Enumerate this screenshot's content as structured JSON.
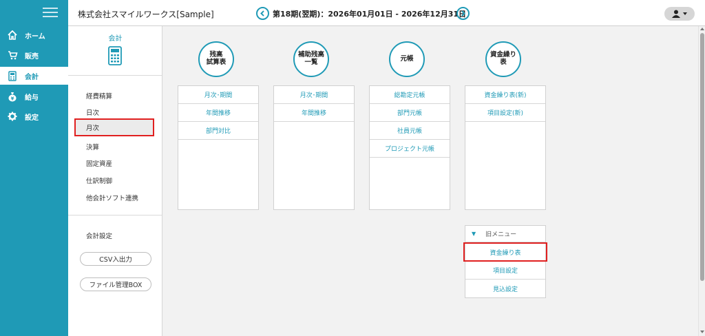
{
  "header": {
    "company": "株式会社スマイルワークス[Sample]",
    "period": "第18期(翌期)：2026年01月01日 - 2026年12月31日"
  },
  "nav": {
    "items": [
      {
        "label": "ホーム",
        "icon": "home-icon"
      },
      {
        "label": "販売",
        "icon": "cart-icon"
      },
      {
        "label": "会計",
        "icon": "calculator-icon"
      },
      {
        "label": "給与",
        "icon": "money-bag-icon"
      },
      {
        "label": "設定",
        "icon": "gear-icon"
      }
    ],
    "active": "会計"
  },
  "subnav": {
    "title": "会計",
    "items": [
      "経費精算",
      "日次",
      "月次",
      "決算",
      "固定資産",
      "仕訳制御",
      "他会計ソフト連携"
    ],
    "selected": "月次",
    "settings": "会計設定",
    "csv_button": "CSV入出力",
    "file_button": "ファイル管理BOX"
  },
  "sections": [
    {
      "title": "残高\n試算表",
      "items": [
        "月次･期間",
        "年間推移",
        "部門対比"
      ]
    },
    {
      "title": "補助残高\n一覧",
      "items": [
        "月次･期間",
        "年間推移"
      ]
    },
    {
      "title": "元帳",
      "items": [
        "総勘定元帳",
        "部門元帳",
        "社員元帳",
        "プロジェクト元帳"
      ]
    },
    {
      "title": "資金繰り\n表",
      "items": [
        "資金繰り表(新)",
        "項目設定(新)"
      ]
    }
  ],
  "old_menu": {
    "title": "旧メニュー",
    "items": [
      "資金繰り表",
      "項目設定",
      "見込設定"
    ]
  },
  "colors": {
    "accent": "#1f9ab6",
    "highlight": "#e01f1f"
  }
}
